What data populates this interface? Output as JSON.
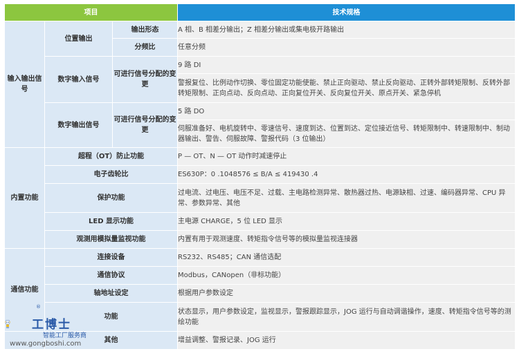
{
  "header": {
    "col1": "项目",
    "col2": "技术规格"
  },
  "groups": {
    "input_output": "输入输出信号",
    "builtin": "内置功能",
    "comm": "通信功能"
  },
  "rows": {
    "pos_out": {
      "label": "位置输出"
    },
    "pos_out_form": {
      "label": "输出形态",
      "value": "A 相、B 相差分输出；Z 相差分输出或集电极开路输出"
    },
    "pos_out_div": {
      "label": "分频比",
      "value": "任意分频"
    },
    "di": {
      "label": "数字输入信号"
    },
    "di_count": {
      "value": "9 路 DI"
    },
    "di_assign": {
      "label": "可进行信号分配的变更",
      "value": "警报复位、比例动作切换、零位固定功能使能、禁止正向驱动、禁止反向驱动、正转外部转矩限制、反转外部转矩限制、正向点动、反向点动、正向复位开关、反向复位开关、原点开关、紧急停机"
    },
    "do": {
      "label": "数字输出信号"
    },
    "do_count": {
      "value": "5 路 DO"
    },
    "do_assign": {
      "label": "可进行信号分配的变更",
      "value": "伺服准备好、电机旋转中、零速信号、速度到达、位置到达、定位接近信号、转矩限制中、转速限制中、制动器输出、警告、伺服故障、警报代码（3 位输出）"
    },
    "ot": {
      "label": "超程（OT）防止功能",
      "value": "P — OT、N — OT 动作时减速停止"
    },
    "gear": {
      "label": "电子齿轮比",
      "value": "ES630P：0 .1048576 ≤ B/A ≤ 419430 .4"
    },
    "protect": {
      "label": "保护功能",
      "value": "过电流、过电压、电压不足、过载、主电路检测异常、散热器过热、电源缺相、过速、编码器异常、CPU 异常、参数异常、其他"
    },
    "led": {
      "label": "LED 显示功能",
      "value": "主电源 CHARGE，5 位 LED 显示"
    },
    "monitor": {
      "label": "观测用模拟量监视功能",
      "value": "内置有用于观测速度、转矩指令信号等的模拟量监视连接器"
    },
    "conn": {
      "label": "连接设备",
      "value": "RS232、RS485；CAN 通信选配"
    },
    "proto": {
      "label": "通信协议",
      "value": "Modbus，CANopen（非标功能）"
    },
    "axis": {
      "label": "轴地址设定",
      "value": "根据用户参数设定"
    },
    "func": {
      "label": "功能",
      "value": "状态显示，用户参数设定，监视显示，警报跟踪显示，JOG 运行与自动调谐操作，速度、转矩指令信号等的测绘功能"
    },
    "other": {
      "label": "其他",
      "value": "增益调整、警报记录、JOG 运行"
    }
  },
  "watermark": {
    "brand": "工博士",
    "tagline": "智能工厂服务商",
    "url": "www.gongboshi.com",
    "reg": "®"
  },
  "colors": {
    "header_left": "#8cc63f",
    "header_right": "#1e8fd6",
    "label_bg": "#dbe8f5",
    "value_bg": "#f0f0f0"
  }
}
